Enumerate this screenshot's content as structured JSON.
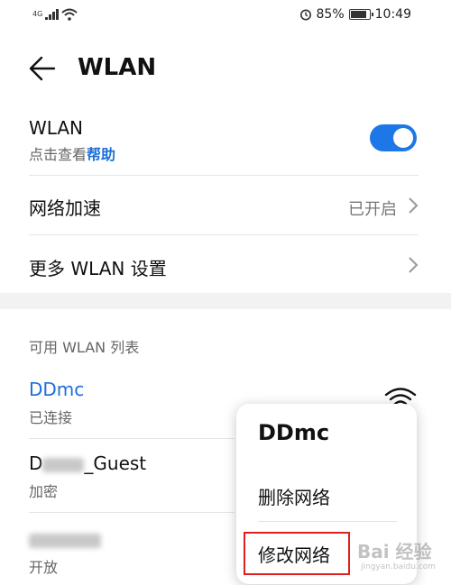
{
  "status_bar": {
    "network_type": "4G",
    "battery_percent": "85%",
    "battery_level": 0.85,
    "time": "10:49",
    "icons": [
      "signal-icon",
      "wifi-icon",
      "alarm-icon",
      "battery-icon"
    ]
  },
  "header": {
    "title": "WLAN"
  },
  "wlan_toggle": {
    "title": "WLAN",
    "subtitle_prefix": "点击查看",
    "help_link": "帮助",
    "enabled": true,
    "accent_color": "#1e77e6"
  },
  "network_acceleration": {
    "title": "网络加速",
    "value": "已开启"
  },
  "more_settings": {
    "title": "更多 WLAN 设置"
  },
  "available_list": {
    "section_title": "可用 WLAN 列表",
    "networks": [
      {
        "name": "DDmc",
        "status": "已连接"
      },
      {
        "name_suffix": "_Guest",
        "status": "加密"
      },
      {
        "status": "开放"
      }
    ]
  },
  "context_menu": {
    "title": "DDmc",
    "items": [
      "删除网络",
      "修改网络"
    ]
  },
  "watermark": {
    "text": "Bai 经验",
    "sub": "jingyan.baidu.com"
  }
}
